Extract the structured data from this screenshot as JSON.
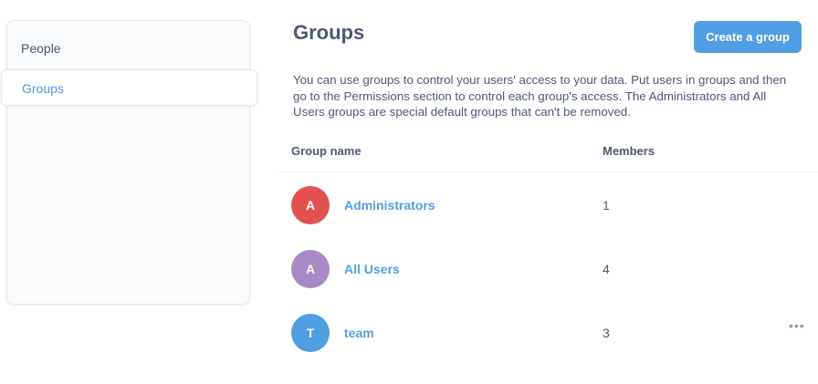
{
  "sidebar": {
    "items": [
      {
        "label": "People"
      },
      {
        "label": "Groups"
      }
    ]
  },
  "header": {
    "title": "Groups",
    "create_label": "Create a group"
  },
  "description": "You can use groups to control your users' access to your data. Put users in groups and then go to the Permissions section to control each group's access. The Administrators and All Users groups are special default groups that can't be removed.",
  "table": {
    "columns": [
      "Group name",
      "Members"
    ],
    "rows": [
      {
        "initial": "A",
        "name": "Administrators",
        "members": "1",
        "color": "#e35050"
      },
      {
        "initial": "A",
        "name": "All Users",
        "members": "4",
        "color": "#a989c5"
      },
      {
        "initial": "T",
        "name": "team",
        "members": "3",
        "color": "#509ee3",
        "more_icon": "more-horizontal-icon"
      }
    ]
  },
  "colors": {
    "brand": "#509ee3",
    "text": "#4c5773"
  }
}
